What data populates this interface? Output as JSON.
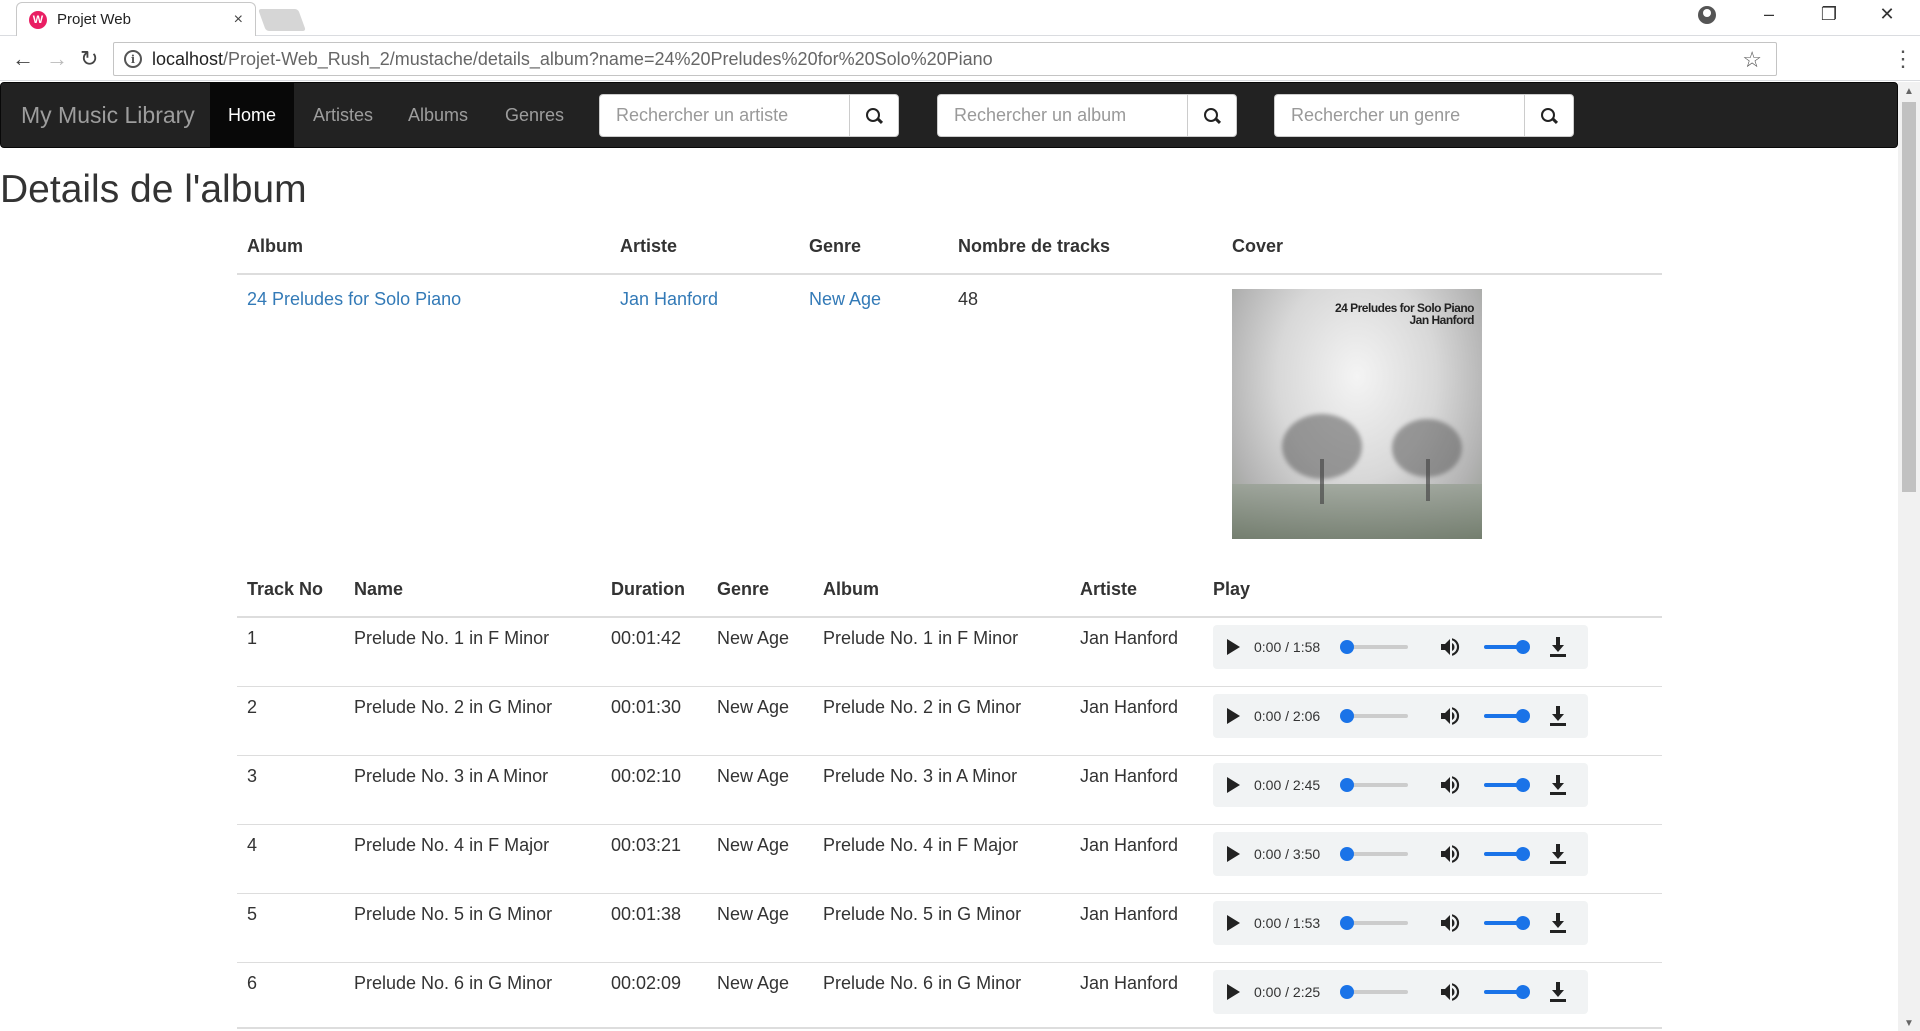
{
  "browser": {
    "tab_title": "Projet Web",
    "tab_close": "×",
    "url_host": "localhost",
    "url_path": "/Projet-Web_Rush_2/mustache/details_album?name=24%20Preludes%20for%20Solo%20Piano"
  },
  "navbar": {
    "brand": "My Music Library",
    "items": [
      {
        "label": "Home",
        "active": true
      },
      {
        "label": "Artistes",
        "active": false
      },
      {
        "label": "Albums",
        "active": false
      },
      {
        "label": "Genres",
        "active": false
      }
    ],
    "search": [
      {
        "placeholder": "Rechercher un artiste"
      },
      {
        "placeholder": "Rechercher un album"
      },
      {
        "placeholder": "Rechercher un genre"
      }
    ]
  },
  "page": {
    "title": "Details de l'album"
  },
  "album_table": {
    "headers": [
      "Album",
      "Artiste",
      "Genre",
      "Nombre de tracks",
      "Cover"
    ],
    "row": {
      "album": "24 Preludes for Solo Piano",
      "artist": "Jan Hanford",
      "genre": "New Age",
      "tracks": "48",
      "cover_title": "24 Preludes for Solo Piano",
      "cover_artist": "Jan Hanford"
    }
  },
  "track_table": {
    "headers": [
      "Track No",
      "Name",
      "Duration",
      "Genre",
      "Album",
      "Artiste",
      "Play"
    ],
    "rows": [
      {
        "no": "1",
        "name": "Prelude No. 1 in F Minor",
        "duration": "00:01:42",
        "genre": "New Age",
        "album": "Prelude No. 1 in F Minor",
        "artist": "Jan Hanford",
        "time": "0:00 / 1:58"
      },
      {
        "no": "2",
        "name": "Prelude No. 2 in G Minor",
        "duration": "00:01:30",
        "genre": "New Age",
        "album": "Prelude No. 2 in G Minor",
        "artist": "Jan Hanford",
        "time": "0:00 / 2:06"
      },
      {
        "no": "3",
        "name": "Prelude No. 3 in A Minor",
        "duration": "00:02:10",
        "genre": "New Age",
        "album": "Prelude No. 3 in A Minor",
        "artist": "Jan Hanford",
        "time": "0:00 / 2:45"
      },
      {
        "no": "4",
        "name": "Prelude No. 4 in F Major",
        "duration": "00:03:21",
        "genre": "New Age",
        "album": "Prelude No. 4 in F Major",
        "artist": "Jan Hanford",
        "time": "0:00 / 3:50"
      },
      {
        "no": "5",
        "name": "Prelude No. 5 in G Minor",
        "duration": "00:01:38",
        "genre": "New Age",
        "album": "Prelude No. 5 in G Minor",
        "artist": "Jan Hanford",
        "time": "0:00 / 1:53"
      },
      {
        "no": "6",
        "name": "Prelude No. 6 in G Minor",
        "duration": "00:02:09",
        "genre": "New Age",
        "album": "Prelude No. 6 in G Minor",
        "artist": "Jan Hanford",
        "time": "0:00 / 2:25"
      }
    ]
  },
  "colors": {
    "navbar_bg": "#222222",
    "link": "#337ab7",
    "player_accent": "#1a73e8"
  },
  "icons": [
    "search-icon",
    "play-icon",
    "volume-icon",
    "download-icon",
    "star-icon",
    "info-icon",
    "back-icon",
    "forward-icon",
    "reload-icon"
  ]
}
